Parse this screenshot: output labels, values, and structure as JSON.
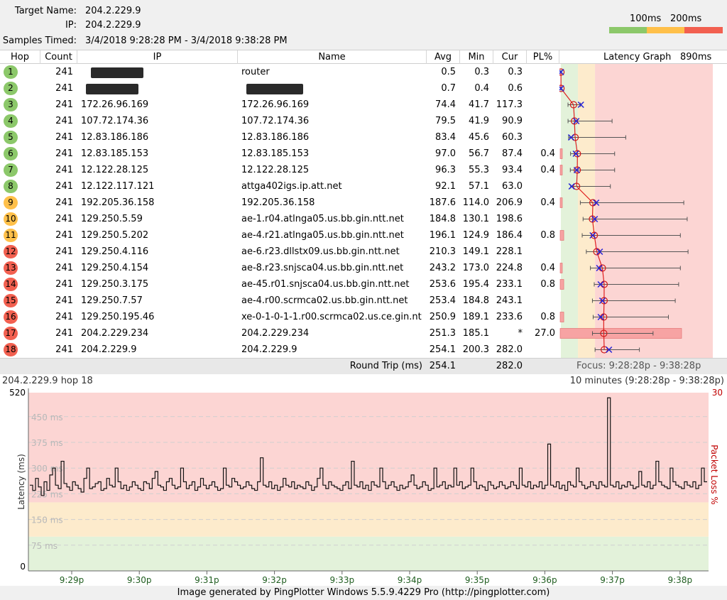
{
  "header": {
    "target_name_label": "Target Name:",
    "target_name": "204.2.229.9",
    "ip_label": "IP:",
    "ip": "204.2.229.9",
    "samples_label": "Samples Timed:",
    "samples": "3/4/2018 9:28:28 PM - 3/4/2018 9:38:28 PM",
    "legend": {
      "label_100": "100ms",
      "label_200": "200ms",
      "colors": [
        "#8cc86a",
        "#ffc04a",
        "#f26050"
      ]
    }
  },
  "table": {
    "columns": [
      "Hop",
      "Count",
      "IP",
      "Name",
      "Avg",
      "Min",
      "Cur",
      "PL%",
      "Latency Graph",
      "890ms"
    ],
    "rows": [
      {
        "hop": "1",
        "count": "241",
        "ip": "",
        "name": "router",
        "avg": "0.5",
        "min": "0.3",
        "cur": "0.3",
        "pl": "",
        "color": "green",
        "redact_ip": true,
        "redact_name": false
      },
      {
        "hop": "2",
        "count": "241",
        "ip": "",
        "name": "",
        "avg": "0.7",
        "min": "0.4",
        "cur": "0.6",
        "pl": "",
        "color": "green",
        "redact_ip": true,
        "redact_name": true
      },
      {
        "hop": "3",
        "count": "241",
        "ip": "172.26.96.169",
        "name": "172.26.96.169",
        "avg": "74.4",
        "min": "41.7",
        "cur": "117.3",
        "pl": "",
        "color": "green"
      },
      {
        "hop": "4",
        "count": "241",
        "ip": "107.72.174.36",
        "name": "107.72.174.36",
        "avg": "79.5",
        "min": "41.9",
        "cur": "90.9",
        "pl": "",
        "color": "green"
      },
      {
        "hop": "5",
        "count": "241",
        "ip": "12.83.186.186",
        "name": "12.83.186.186",
        "avg": "83.4",
        "min": "45.6",
        "cur": "60.3",
        "pl": "",
        "color": "green"
      },
      {
        "hop": "6",
        "count": "241",
        "ip": "12.83.185.153",
        "name": "12.83.185.153",
        "avg": "97.0",
        "min": "56.7",
        "cur": "87.4",
        "pl": "0.4",
        "color": "green"
      },
      {
        "hop": "7",
        "count": "241",
        "ip": "12.122.28.125",
        "name": "12.122.28.125",
        "avg": "96.3",
        "min": "55.3",
        "cur": "93.4",
        "pl": "0.4",
        "color": "green"
      },
      {
        "hop": "8",
        "count": "241",
        "ip": "12.122.117.121",
        "name": "attga402igs.ip.att.net",
        "avg": "92.1",
        "min": "57.1",
        "cur": "63.0",
        "pl": "",
        "color": "green"
      },
      {
        "hop": "9",
        "count": "241",
        "ip": "192.205.36.158",
        "name": "192.205.36.158",
        "avg": "187.6",
        "min": "114.0",
        "cur": "206.9",
        "pl": "0.4",
        "color": "yellow"
      },
      {
        "hop": "10",
        "count": "241",
        "ip": "129.250.5.59",
        "name": "ae-1.r04.atlnga05.us.bb.gin.ntt.net",
        "avg": "184.8",
        "min": "130.1",
        "cur": "198.6",
        "pl": "",
        "color": "yellow"
      },
      {
        "hop": "11",
        "count": "241",
        "ip": "129.250.5.202",
        "name": "ae-4.r21.atlnga05.us.bb.gin.ntt.net",
        "avg": "196.1",
        "min": "124.9",
        "cur": "186.4",
        "pl": "0.8",
        "color": "yellow"
      },
      {
        "hop": "12",
        "count": "241",
        "ip": "129.250.4.116",
        "name": "ae-6.r23.dllstx09.us.bb.gin.ntt.net",
        "avg": "210.3",
        "min": "149.1",
        "cur": "228.1",
        "pl": "",
        "color": "red"
      },
      {
        "hop": "13",
        "count": "241",
        "ip": "129.250.4.154",
        "name": "ae-8.r23.snjsca04.us.bb.gin.ntt.net",
        "avg": "243.2",
        "min": "173.0",
        "cur": "224.8",
        "pl": "0.4",
        "color": "red"
      },
      {
        "hop": "14",
        "count": "241",
        "ip": "129.250.3.175",
        "name": "ae-45.r01.snjsca04.us.bb.gin.ntt.net",
        "avg": "253.6",
        "min": "195.4",
        "cur": "233.1",
        "pl": "0.8",
        "color": "red"
      },
      {
        "hop": "15",
        "count": "241",
        "ip": "129.250.7.57",
        "name": "ae-4.r00.scrmca02.us.bb.gin.ntt.net",
        "avg": "253.4",
        "min": "184.8",
        "cur": "243.1",
        "pl": "",
        "color": "red"
      },
      {
        "hop": "16",
        "count": "241",
        "ip": "129.250.195.46",
        "name": "xe-0-1-0-1-1.r00.scrmca02.us.ce.gin.nt",
        "avg": "250.9",
        "min": "189.1",
        "cur": "233.6",
        "pl": "0.8",
        "color": "red"
      },
      {
        "hop": "17",
        "count": "241",
        "ip": "204.2.229.234",
        "name": "204.2.229.234",
        "avg": "251.3",
        "min": "185.1",
        "cur": "*",
        "pl": "27.0",
        "color": "red"
      },
      {
        "hop": "18",
        "count": "241",
        "ip": "204.2.229.9",
        "name": "204.2.229.9",
        "avg": "254.1",
        "min": "200.3",
        "cur": "282.0",
        "pl": "",
        "color": "red"
      }
    ],
    "footer": {
      "label": "Round Trip (ms)",
      "avg": "254.1",
      "cur": "282.0",
      "focus": "Focus: 9:28:28p - 9:38:28p"
    },
    "graph_max_ms": 890,
    "graph_max_values_ms": [
      0.9,
      1.0,
      115,
      300,
      380,
      315,
      315,
      290,
      720,
      740,
      700,
      745,
      700,
      690,
      670,
      630,
      540,
      460
    ]
  },
  "timeline": {
    "title_left": "204.2.229.9 hop 18",
    "title_right": "10 minutes (9:28:28p - 9:38:28p)",
    "ylabel": "Latency (ms)",
    "y2label": "Packet Loss %",
    "y_top": "520",
    "y_bottom": "0",
    "y2_top": "30",
    "gridlines": [
      "450 ms",
      "375 ms",
      "300 ms",
      "225 ms",
      "150 ms",
      "75 ms"
    ],
    "xticks": [
      "9:29p",
      "9:30p",
      "9:31p",
      "9:32p",
      "9:33p",
      "9:34p",
      "9:35p",
      "9:36p",
      "9:37p",
      "9:38p"
    ]
  },
  "chart_data": {
    "type": "line",
    "title": "204.2.229.9 hop 18",
    "xlabel": "",
    "ylabel": "Latency (ms)",
    "ylim": [
      0,
      520
    ],
    "y2label": "Packet Loss %",
    "y2lim": [
      0,
      30
    ],
    "x_range": [
      "9:28:28p",
      "9:38:28p"
    ],
    "xticks": [
      "9:29p",
      "9:30p",
      "9:31p",
      "9:32p",
      "9:33p",
      "9:34p",
      "9:35p",
      "9:36p",
      "9:37p",
      "9:38p"
    ],
    "zones": [
      {
        "from": 0,
        "to": 100,
        "color": "#e3f2da"
      },
      {
        "from": 100,
        "to": 200,
        "color": "#fdebcc"
      },
      {
        "from": 200,
        "to": 520,
        "color": "#fcd5d3"
      }
    ],
    "series": [
      {
        "values": [
          250,
          235,
          270,
          245,
          220,
          260,
          235,
          280,
          300,
          250,
          240,
          320,
          255,
          245,
          235,
          260,
          250,
          240,
          230,
          270,
          300,
          240,
          245,
          255,
          260,
          235,
          240,
          270,
          250,
          245,
          300,
          260,
          240,
          250,
          235,
          245,
          260,
          250,
          240,
          235,
          260,
          255,
          240,
          270,
          290,
          250,
          245,
          235,
          260,
          270,
          250,
          240,
          245,
          300,
          260,
          240,
          250,
          260,
          235,
          245,
          270,
          250,
          240,
          250,
          260,
          245,
          235,
          240,
          300,
          250,
          245,
          270,
          260,
          250,
          240,
          245,
          260,
          250,
          240,
          235,
          260,
          330,
          250,
          245,
          260,
          240,
          250,
          235,
          245,
          270,
          250,
          245,
          260,
          240,
          250,
          245,
          240,
          260,
          250,
          235,
          245,
          270,
          300,
          250,
          240,
          260,
          250,
          245,
          240,
          235,
          250,
          260,
          240,
          320,
          250,
          245,
          260,
          240,
          250,
          235,
          260,
          250,
          245,
          300,
          260,
          240,
          250,
          260,
          245,
          235,
          250,
          240,
          245,
          260,
          280,
          250,
          240,
          245,
          260,
          250,
          235,
          240,
          300,
          245,
          250,
          260,
          240,
          250,
          245,
          300,
          250,
          260,
          240,
          245,
          250,
          300,
          260,
          240,
          250,
          245,
          235,
          260,
          250,
          240,
          245,
          260,
          250,
          240,
          245,
          260,
          250,
          240,
          300,
          250,
          245,
          260,
          240,
          250,
          245,
          260,
          240,
          250,
          370,
          250,
          245,
          260,
          240,
          250,
          235,
          260,
          250,
          245,
          300,
          260,
          250,
          240,
          245,
          260,
          250,
          240,
          260,
          250,
          245,
          505,
          250,
          245,
          260,
          240,
          250,
          245,
          260,
          250,
          240,
          245,
          290,
          250,
          245,
          260,
          240,
          250,
          320,
          260,
          250,
          245,
          240,
          300,
          260,
          250,
          245,
          240,
          260,
          250,
          245,
          260,
          240,
          250,
          300,
          260
        ]
      }
    ]
  },
  "footer_text": "Image generated by PingPlotter Windows 5.5.9.4229 Pro (http://pingplotter.com)"
}
